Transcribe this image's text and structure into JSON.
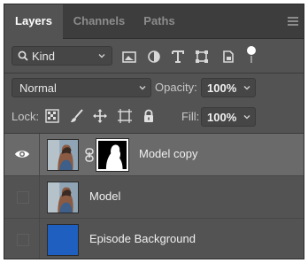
{
  "tabs": [
    {
      "label": "Layers",
      "active": true
    },
    {
      "label": "Channels",
      "active": false
    },
    {
      "label": "Paths",
      "active": false
    }
  ],
  "filter": {
    "kind_label": "Kind",
    "icons": [
      "pixel-filter-icon",
      "adjustment-filter-icon",
      "type-filter-icon",
      "shape-filter-icon",
      "smart-object-filter-icon",
      "filter-toggle-icon"
    ]
  },
  "blend": {
    "mode": "Normal",
    "opacity_label": "Opacity:",
    "opacity_value": "100%"
  },
  "lock": {
    "label": "Lock:",
    "icons": [
      "lock-transparent-pixels-icon",
      "lock-image-pixels-icon",
      "lock-position-icon",
      "lock-artboard-icon",
      "lock-all-icon"
    ],
    "fill_label": "Fill:",
    "fill_value": "100%"
  },
  "layers": [
    {
      "name": "Model copy",
      "visible": true,
      "selected": true,
      "has_mask": true
    },
    {
      "name": "Model",
      "visible": false,
      "selected": false,
      "has_mask": false
    },
    {
      "name": "Episode Background",
      "visible": false,
      "selected": false,
      "has_mask": false,
      "fill_color": "#1f5fbf"
    }
  ],
  "colors": {
    "panel_bg": "#535353",
    "selected_row": "#6a6a6a",
    "tab_bar": "#3d3d3d"
  }
}
